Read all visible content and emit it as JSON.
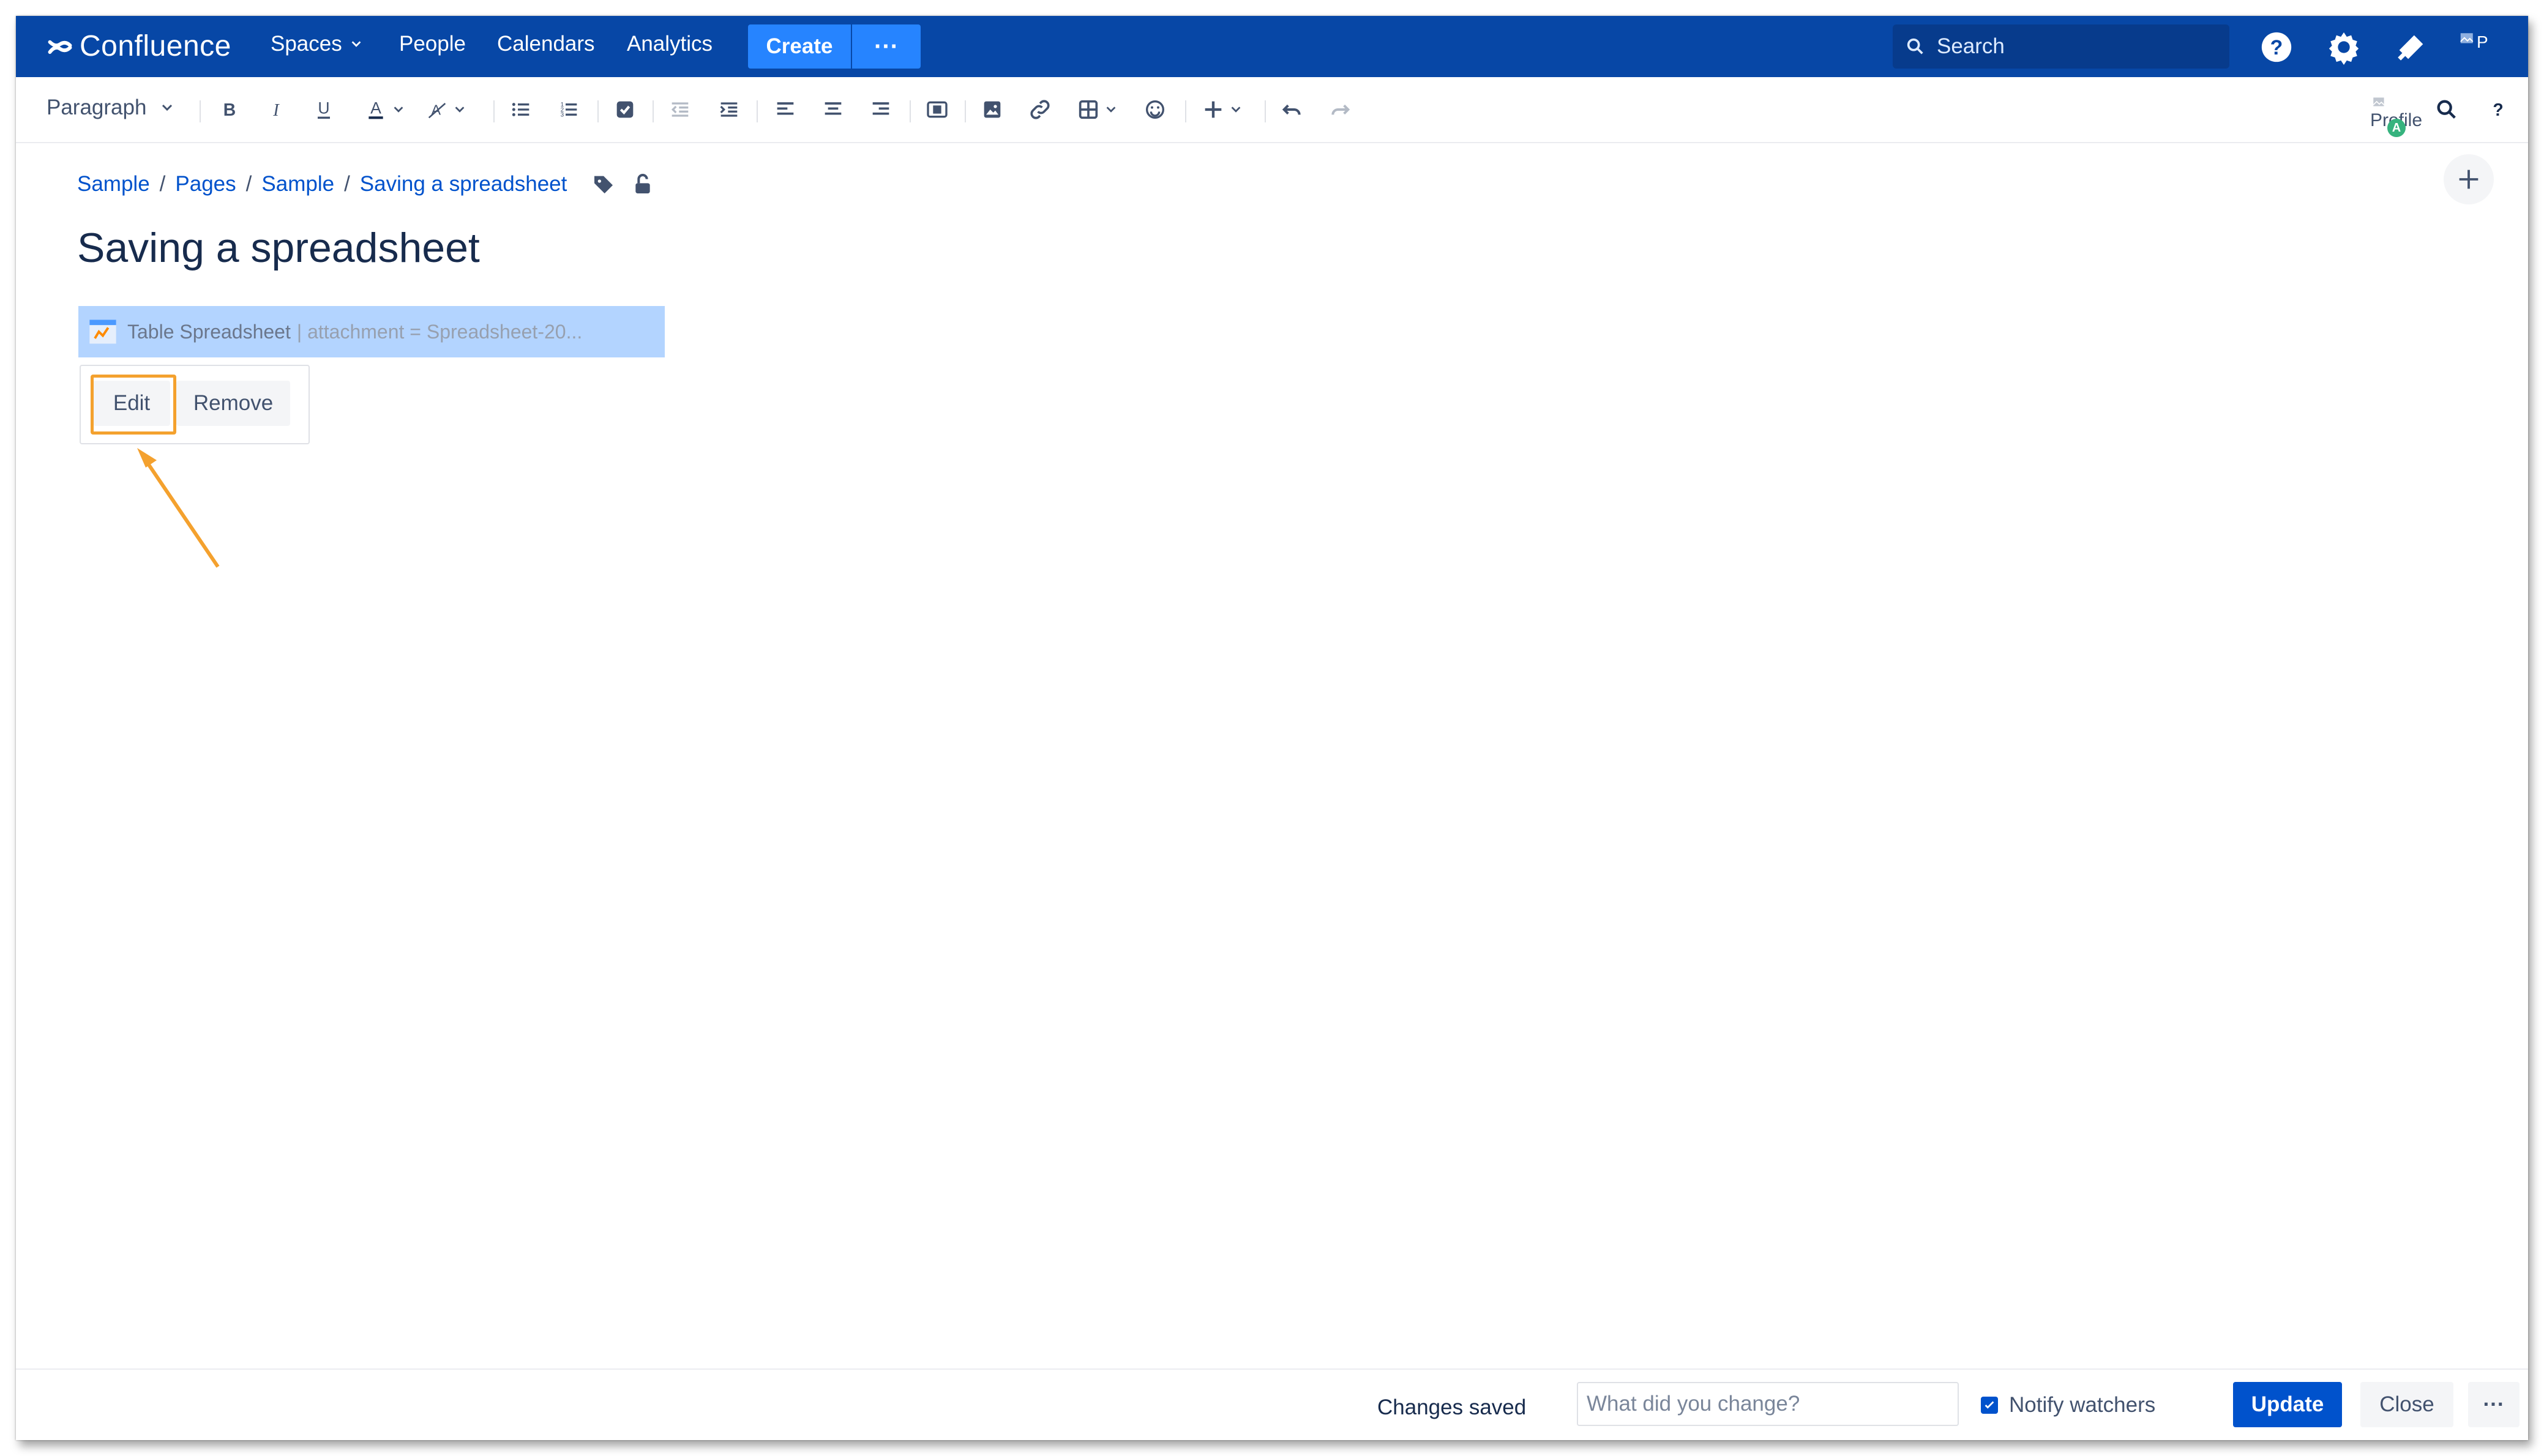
{
  "app": {
    "name": "Confluence",
    "brand_color": "#0747a6",
    "accent_color": "#0052cc"
  },
  "nav": {
    "spaces": "Spaces",
    "people": "People",
    "calendars": "Calendars",
    "analytics": "Analytics",
    "create": "Create",
    "more": "···",
    "search_placeholder": "Search"
  },
  "toolbar": {
    "paragraph": "Paragraph",
    "profile_alt": "Profile",
    "profile_badge": "A",
    "icons": [
      "bold-icon",
      "italic-icon",
      "underline-icon",
      "text-color-icon",
      "clear-formatting-icon",
      "bullet-list-icon",
      "numbered-list-icon",
      "task-icon",
      "outdent-icon",
      "indent-icon",
      "align-left-icon",
      "align-center-icon",
      "align-right-icon",
      "page-layout-icon",
      "image-icon",
      "link-icon",
      "table-icon",
      "emoji-icon",
      "insert-icon",
      "undo-icon",
      "redo-icon",
      "find-icon",
      "help-icon"
    ]
  },
  "breadcrumb": [
    "Sample",
    "Pages",
    "Sample",
    "Saving a spreadsheet"
  ],
  "page": {
    "title": "Saving a spreadsheet"
  },
  "macro": {
    "name": "Table Spreadsheet",
    "params": "| attachment = Spreadsheet-20...",
    "edit": "Edit",
    "remove": "Remove",
    "highlight_color": "#f4a12e"
  },
  "footer": {
    "status": "Changes saved",
    "change_placeholder": "What did you change?",
    "notify": "Notify watchers",
    "notify_checked": true,
    "update": "Update",
    "close": "Close",
    "more": "···"
  }
}
